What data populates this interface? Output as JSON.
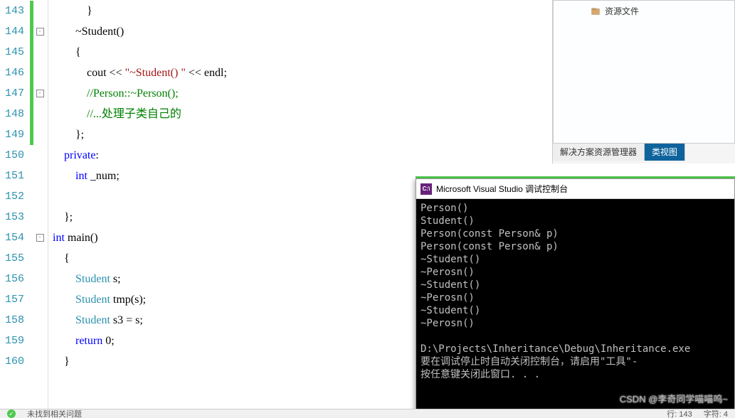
{
  "editor": {
    "lines": [
      {
        "num": "143",
        "marker": "green",
        "fold": "",
        "indent": 3,
        "tokens": [
          {
            "t": "txt",
            "v": "}"
          }
        ]
      },
      {
        "num": "144",
        "marker": "green",
        "fold": "-",
        "indent": 2,
        "tokens": [
          {
            "t": "txt",
            "v": "~Student()"
          }
        ]
      },
      {
        "num": "145",
        "marker": "green",
        "fold": "",
        "indent": 2,
        "tokens": [
          {
            "t": "txt",
            "v": "{"
          }
        ]
      },
      {
        "num": "146",
        "marker": "green",
        "fold": "",
        "indent": 3,
        "tokens": [
          {
            "t": "txt",
            "v": "cout << "
          },
          {
            "t": "str",
            "v": "\"~Student() \""
          },
          {
            "t": "txt",
            "v": " << endl;"
          }
        ]
      },
      {
        "num": "147",
        "marker": "green",
        "fold": "-",
        "indent": 3,
        "tokens": [
          {
            "t": "comment",
            "v": "//Person::~Person();"
          }
        ]
      },
      {
        "num": "148",
        "marker": "green",
        "fold": "",
        "indent": 3,
        "tokens": [
          {
            "t": "comment",
            "v": "//...处理子类自己的"
          }
        ]
      },
      {
        "num": "149",
        "marker": "green",
        "fold": "",
        "indent": 2,
        "tokens": [
          {
            "t": "txt",
            "v": "};"
          }
        ]
      },
      {
        "num": "150",
        "marker": "",
        "fold": "",
        "indent": 1,
        "tokens": [
          {
            "t": "kw",
            "v": "private"
          },
          {
            "t": "txt",
            "v": ":"
          }
        ]
      },
      {
        "num": "151",
        "marker": "",
        "fold": "",
        "indent": 2,
        "tokens": [
          {
            "t": "kw",
            "v": "int"
          },
          {
            "t": "txt",
            "v": " _num;"
          }
        ]
      },
      {
        "num": "152",
        "marker": "",
        "fold": "",
        "indent": 0,
        "tokens": []
      },
      {
        "num": "153",
        "marker": "",
        "fold": "",
        "indent": 1,
        "tokens": [
          {
            "t": "txt",
            "v": "};"
          }
        ]
      },
      {
        "num": "154",
        "marker": "",
        "fold": "-",
        "indent": 0,
        "tokens": [
          {
            "t": "kw",
            "v": "int"
          },
          {
            "t": "txt",
            "v": " main()"
          }
        ]
      },
      {
        "num": "155",
        "marker": "",
        "fold": "",
        "indent": 1,
        "tokens": [
          {
            "t": "txt",
            "v": "{"
          }
        ]
      },
      {
        "num": "156",
        "marker": "",
        "fold": "",
        "indent": 2,
        "tokens": [
          {
            "t": "type",
            "v": "Student"
          },
          {
            "t": "txt",
            "v": " s;"
          }
        ]
      },
      {
        "num": "157",
        "marker": "",
        "fold": "",
        "indent": 2,
        "tokens": [
          {
            "t": "type",
            "v": "Student"
          },
          {
            "t": "txt",
            "v": " tmp(s);"
          }
        ]
      },
      {
        "num": "158",
        "marker": "",
        "fold": "",
        "indent": 2,
        "tokens": [
          {
            "t": "type",
            "v": "Student"
          },
          {
            "t": "txt",
            "v": " s3 = s;"
          }
        ]
      },
      {
        "num": "159",
        "marker": "",
        "fold": "",
        "indent": 2,
        "tokens": [
          {
            "t": "kw",
            "v": "return"
          },
          {
            "t": "txt",
            "v": " 0;"
          }
        ]
      },
      {
        "num": "160",
        "marker": "",
        "fold": "",
        "indent": 1,
        "tokens": [
          {
            "t": "txt",
            "v": "}"
          }
        ]
      }
    ]
  },
  "right_panel": {
    "tree_item": "资源文件",
    "tabs": [
      "解决方案资源管理器",
      "类视图"
    ],
    "active_tab": 1
  },
  "console": {
    "title": "Microsoft Visual Studio 调试控制台",
    "output": [
      "Person()",
      "Student()",
      "Person(const Person& p)",
      "Person(const Person& p)",
      "~Student()",
      "~Perosn()",
      "~Student()",
      "~Perosn()",
      "~Student()",
      "~Perosn()",
      "",
      "D:\\Projects\\Inheritance\\Debug\\Inheritance.exe",
      "要在调试停止时自动关闭控制台，请启用\"工具\"-",
      "按任意键关闭此窗口. . ."
    ]
  },
  "status": {
    "issues": "未找到相关问题",
    "line": "行: 143",
    "col": "字符: 4"
  },
  "watermark": "CSDN @李奇同学喵喵呜~"
}
